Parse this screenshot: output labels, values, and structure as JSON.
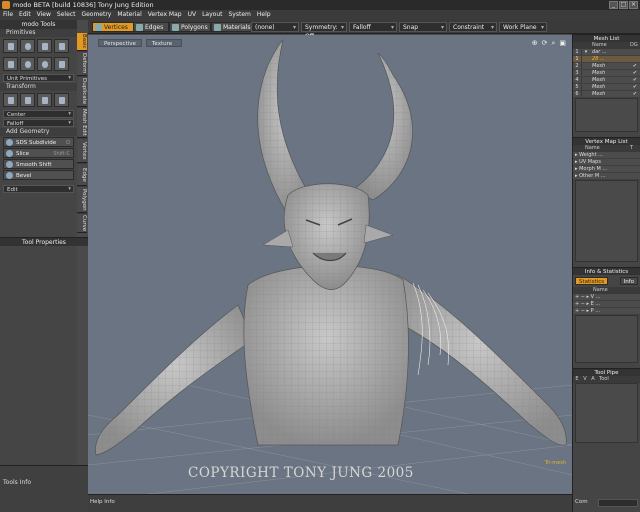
{
  "window": {
    "title": "modo BETA [build 10836] Tony Jung Edition",
    "min": "_",
    "max": "□",
    "close": "×"
  },
  "menu": [
    "File",
    "Edit",
    "View",
    "Select",
    "Geometry",
    "Material",
    "Vertex Map",
    "UV",
    "Layout",
    "System",
    "Help"
  ],
  "toolbar": {
    "modes": [
      {
        "label": "Vertices",
        "active": true
      },
      {
        "label": "Edges"
      },
      {
        "label": "Polygons"
      },
      {
        "label": "Materials"
      }
    ],
    "dropdowns": [
      "(none)",
      "Symmetry: Off",
      "Falloff",
      "Snap",
      "Constraint",
      "Work Plane"
    ]
  },
  "left": {
    "header": "modo Tools",
    "primitives_label": "Primitives",
    "unit_primitives": "Unit Primitives",
    "transform_label": "Transform",
    "center_dropdown": "Center",
    "falloff_dropdown": "Falloff",
    "add_geometry_label": "Add Geometry",
    "tools": [
      {
        "label": "SDS Subdivide",
        "hotkey": "D"
      },
      {
        "label": "Slice",
        "hotkey": "Shift-C"
      },
      {
        "label": "Smooth Shift",
        "hotkey": ""
      },
      {
        "label": "Bevel",
        "hotkey": ""
      }
    ],
    "edit_dropdown": "Edit",
    "tool_properties": "Tool Properties",
    "tools_info": "Tools Info",
    "vtabs": [
      "Basic",
      "Deform",
      "Duplicate",
      "Mesh Edit",
      "Vertex",
      "Edge",
      "Polygon",
      "Curve"
    ]
  },
  "viewport": {
    "tabs": [
      "Perspective",
      "Texture"
    ],
    "nav_icons": [
      "⊕",
      "⟳",
      "⌕",
      "▣"
    ],
    "copyright": "COPYRIGHT TONY JUNG 2005",
    "badge": "Tri-mesh"
  },
  "help_info": "Help Info",
  "right": {
    "mesh_list": {
      "title": "Mesh List",
      "headers": [
        "Name",
        "DG"
      ],
      "rows": [
        {
          "idx": "1",
          "name": "dar ...",
          "flag": ""
        },
        {
          "idx": "1",
          "name": "28 ...",
          "flag": ""
        },
        {
          "idx": "2",
          "name": "Mesh",
          "flag": "✔"
        },
        {
          "idx": "3",
          "name": "Mesh",
          "flag": "✔"
        },
        {
          "idx": "4",
          "name": "Mesh",
          "flag": "✔"
        },
        {
          "idx": "5",
          "name": "Mesh",
          "flag": "✔"
        },
        {
          "idx": "6",
          "name": "Mesh",
          "flag": "✔"
        }
      ]
    },
    "vertex_map_list": {
      "title": "Vertex Map List",
      "headers": [
        "Name",
        "T"
      ],
      "rows": [
        "Weight ...",
        "UV Maps",
        "Morph M ...",
        "Other M ..."
      ]
    },
    "info_stats": {
      "title": "Info & Statistics",
      "tabs": [
        "Statistics",
        "Info"
      ],
      "header": "Name",
      "rows": [
        "V ...",
        "E ...",
        "P ..."
      ]
    },
    "tool_pipe": {
      "title": "Tool Pipe",
      "headers": [
        "E",
        "V",
        "A",
        "Tool"
      ]
    },
    "command_label": "Com"
  },
  "colors": {
    "accent": "#e49a22",
    "viewport_bg": "#6a7482",
    "panel_bg": "#454545"
  }
}
